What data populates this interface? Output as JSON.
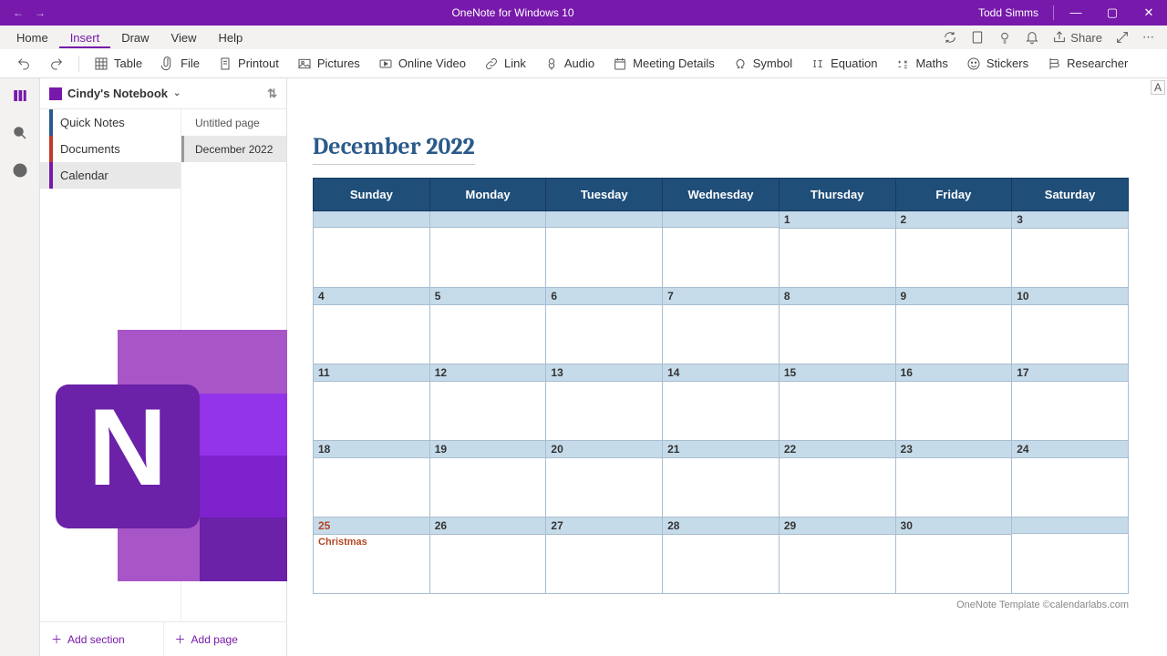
{
  "title_bar": {
    "app_title": "OneNote for Windows 10",
    "user": "Todd Simms"
  },
  "menu": {
    "tabs": [
      "Home",
      "Insert",
      "Draw",
      "View",
      "Help"
    ],
    "active": 1,
    "share": "Share"
  },
  "ribbon": {
    "table": "Table",
    "file": "File",
    "printout": "Printout",
    "pictures": "Pictures",
    "video": "Online Video",
    "link": "Link",
    "audio": "Audio",
    "meeting": "Meeting Details",
    "symbol": "Symbol",
    "equation": "Equation",
    "maths": "Maths",
    "stickers": "Stickers",
    "researcher": "Researcher"
  },
  "notebook": {
    "name": "Cindy's Notebook",
    "sections": [
      {
        "label": "Quick Notes",
        "color": "#2a5a8a"
      },
      {
        "label": "Documents",
        "color": "#c0392b"
      },
      {
        "label": "Calendar",
        "color": "#7719AA"
      }
    ],
    "pages": [
      {
        "label": "Untitled page"
      },
      {
        "label": "December 2022"
      }
    ],
    "add_section": "Add section",
    "add_page": "Add page"
  },
  "calendar": {
    "title": "December 2022",
    "days": [
      "Sunday",
      "Monday",
      "Tuesday",
      "Wednesday",
      "Thursday",
      "Friday",
      "Saturday"
    ],
    "weeks": [
      [
        {
          "n": ""
        },
        {
          "n": ""
        },
        {
          "n": ""
        },
        {
          "n": ""
        },
        {
          "n": "1"
        },
        {
          "n": "2"
        },
        {
          "n": "3"
        }
      ],
      [
        {
          "n": "4"
        },
        {
          "n": "5"
        },
        {
          "n": "6"
        },
        {
          "n": "7"
        },
        {
          "n": "8"
        },
        {
          "n": "9"
        },
        {
          "n": "10"
        }
      ],
      [
        {
          "n": "11"
        },
        {
          "n": "12"
        },
        {
          "n": "13"
        },
        {
          "n": "14"
        },
        {
          "n": "15"
        },
        {
          "n": "16"
        },
        {
          "n": "17"
        }
      ],
      [
        {
          "n": "18"
        },
        {
          "n": "19"
        },
        {
          "n": "20"
        },
        {
          "n": "21"
        },
        {
          "n": "22"
        },
        {
          "n": "23"
        },
        {
          "n": "24"
        }
      ],
      [
        {
          "n": "25",
          "holiday": true,
          "event": "Christmas"
        },
        {
          "n": "26"
        },
        {
          "n": "27"
        },
        {
          "n": "28"
        },
        {
          "n": "29"
        },
        {
          "n": "30"
        },
        {
          "n": ""
        }
      ]
    ],
    "footer": "OneNote Template ©calendarlabs.com"
  },
  "format_strip": "A"
}
